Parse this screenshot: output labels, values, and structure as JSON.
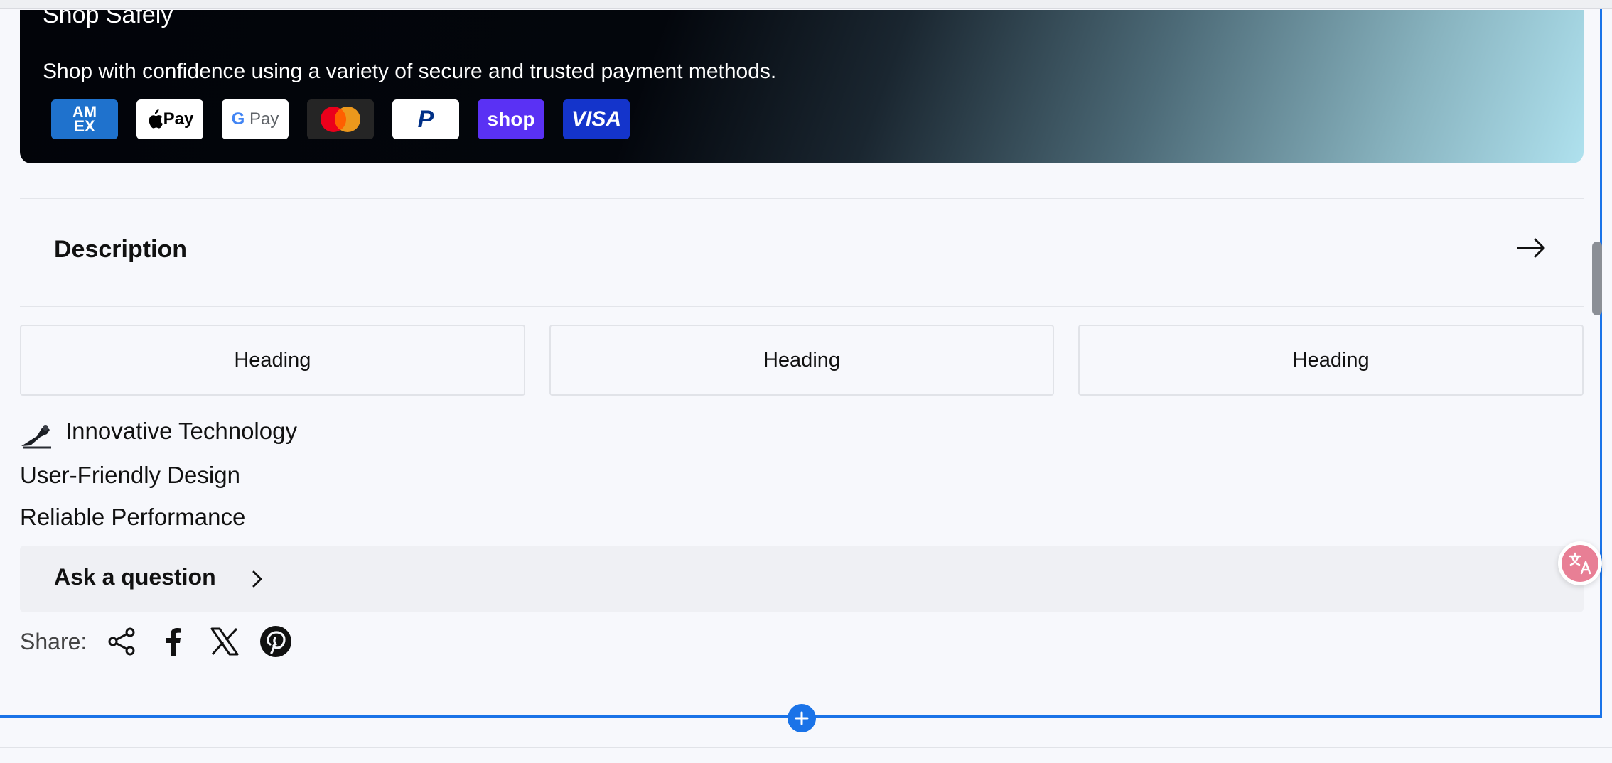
{
  "banner": {
    "title": "Shop Safely",
    "text": "Shop with confidence using a variety of secure and trusted payment methods.",
    "payment_methods": [
      "AMEX",
      "Pay",
      "G Pay",
      "Mastercard",
      "PayPal",
      "shop",
      "VISA"
    ]
  },
  "description": {
    "title": "Description"
  },
  "headings": [
    "Heading",
    "Heading",
    "Heading"
  ],
  "features": [
    "Innovative Technology",
    "User-Friendly Design",
    "Reliable Performance"
  ],
  "ask": {
    "label": "Ask a question"
  },
  "share": {
    "label": "Share:"
  },
  "colors": {
    "accent": "#1a73e8",
    "translate": "#e87f95"
  }
}
